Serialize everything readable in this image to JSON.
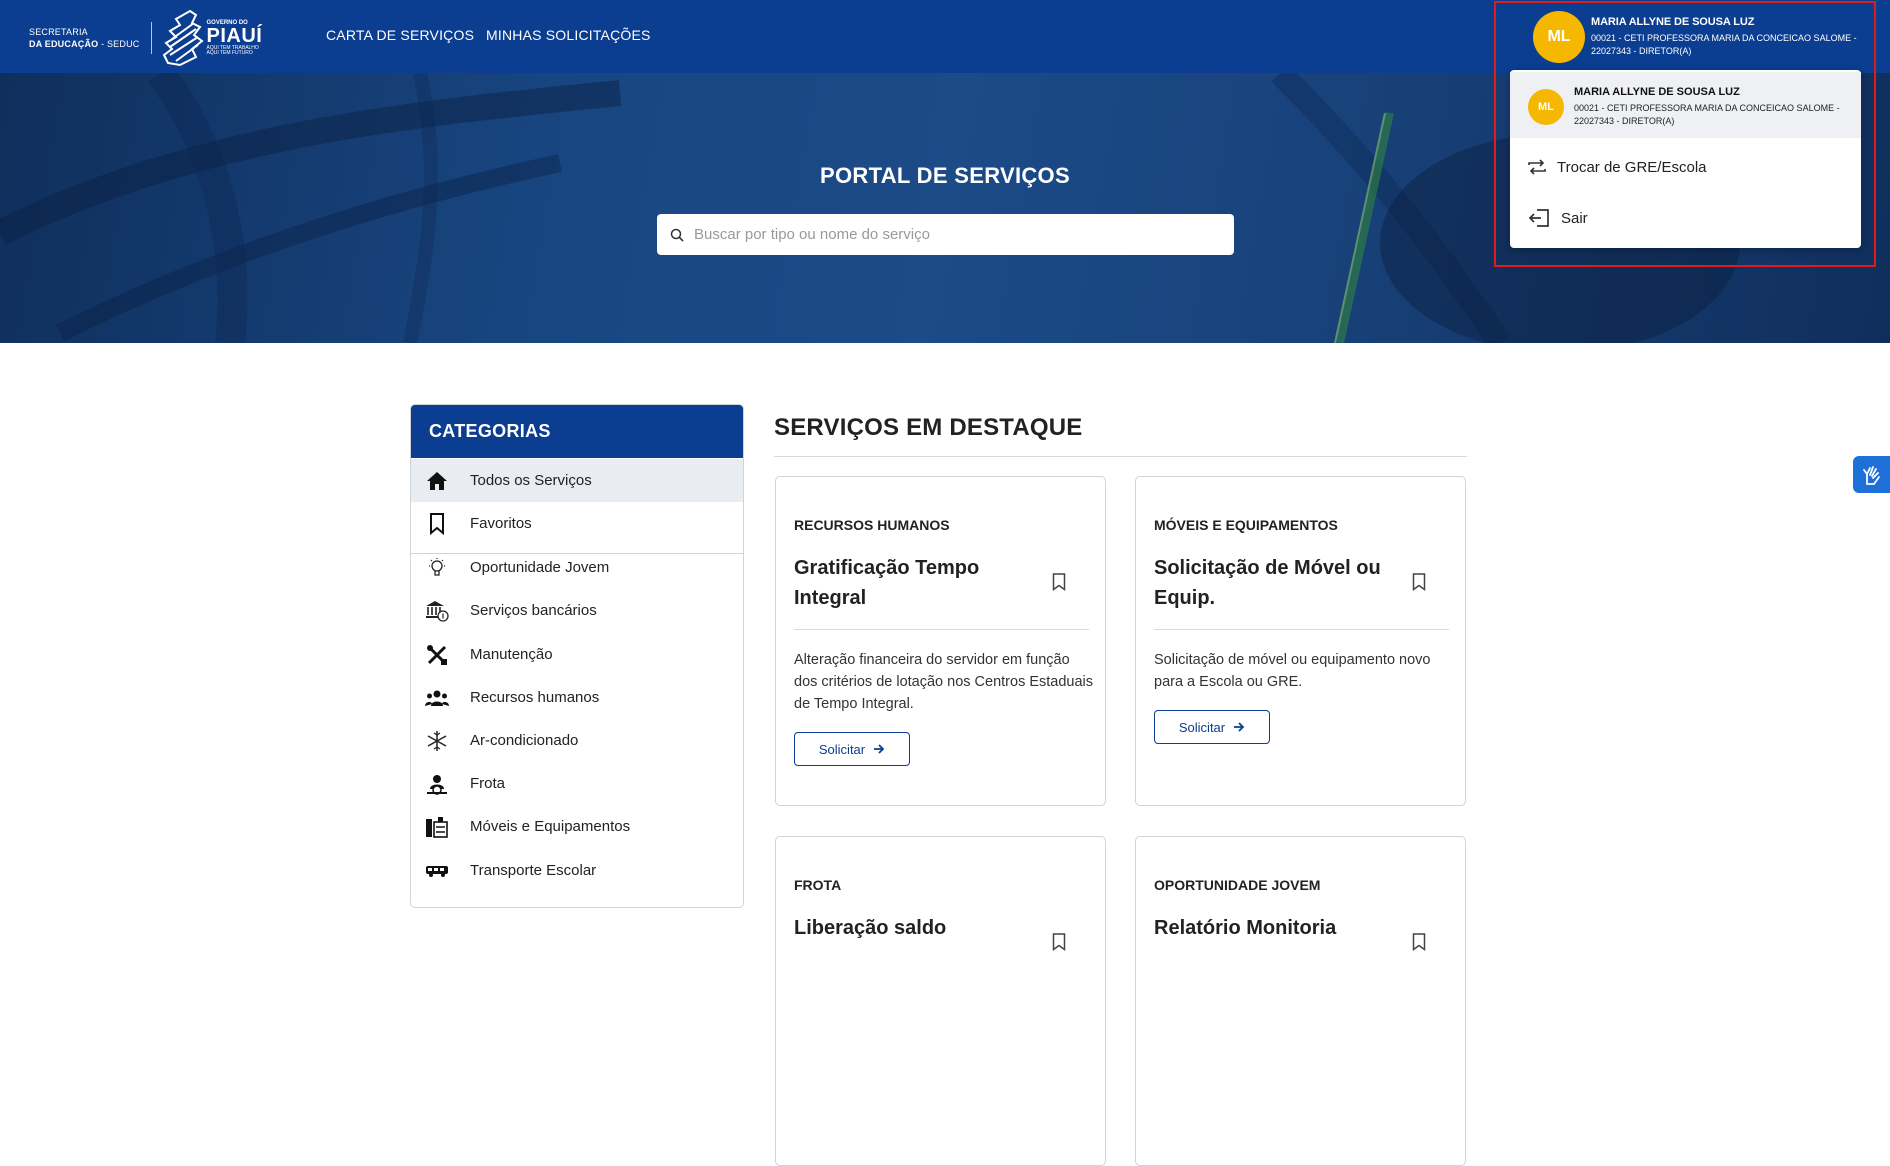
{
  "header": {
    "logo_left_line1": "SECRETARIA",
    "logo_left_line2_bold": "DA EDUCAÇÃO",
    "logo_left_line2_rest": " - SEDUC",
    "logo_gov_small": "GOVERNO DO",
    "logo_gov_big": "PIAUÍ",
    "logo_gov_tag1": "AQUI TEM TRABALHO",
    "logo_gov_tag2": "AQUI TEM FUTURO",
    "nav": [
      "CARTA DE SERVIÇOS",
      "MINHAS SOLICITAÇÕES"
    ]
  },
  "user": {
    "initials": "ML",
    "name": "MARIA ALLYNE DE SOUSA LUZ",
    "school_line": "00021 - CETI PROFESSORA MARIA DA CONCEICAO SALOME - 22027343 - DIRETOR(A)"
  },
  "dropdown": {
    "items": [
      {
        "label": "Trocar de GRE/Escola",
        "icon": "swap-icon"
      },
      {
        "label": "Sair",
        "icon": "logout-icon"
      }
    ]
  },
  "hero": {
    "title": "PORTAL DE SERVIÇOS",
    "search_placeholder": "Buscar por tipo ou nome do serviço"
  },
  "categories": {
    "title": "CATEGORIAS",
    "items": [
      {
        "label": "Todos os Serviços",
        "icon": "home-icon",
        "active": true
      },
      {
        "label": "Favoritos",
        "icon": "bookmark-icon"
      },
      {
        "label": "Oportunidade Jovem",
        "icon": "lightbulb-icon"
      },
      {
        "label": "Serviços bancários",
        "icon": "bank-icon"
      },
      {
        "label": "Manutenção",
        "icon": "tools-icon"
      },
      {
        "label": "Recursos humanos",
        "icon": "people-icon"
      },
      {
        "label": "Ar-condicionado",
        "icon": "snowflake-icon"
      },
      {
        "label": "Frota",
        "icon": "driver-icon"
      },
      {
        "label": "Móveis e Equipamentos",
        "icon": "furniture-icon"
      },
      {
        "label": "Transporte Escolar",
        "icon": "bus-icon"
      }
    ]
  },
  "featured": {
    "title": "SERVIÇOS EM DESTAQUE",
    "cards": [
      {
        "category": "RECURSOS HUMANOS",
        "title": "Gratificação Tempo Integral",
        "description": "Alteração financeira do servidor em função dos critérios de lotação nos Centros Estaduais de Tempo Integral.",
        "button": "Solicitar"
      },
      {
        "category": "MÓVEIS E EQUIPAMENTOS",
        "title": "Solicitação de Móvel ou Equip.",
        "description": "Solicitação de móvel ou equipamento novo para a Escola ou GRE.",
        "button": "Solicitar"
      },
      {
        "category": "FROTA",
        "title": "Liberação saldo"
      },
      {
        "category": "OPORTUNIDADE JOVEM",
        "title": "Relatório Monitoria"
      }
    ]
  },
  "colors": {
    "primary": "#0b3d91",
    "avatar": "#f6b700",
    "highlight_border": "#e01b1b",
    "a11y": "#1f6fd8"
  }
}
